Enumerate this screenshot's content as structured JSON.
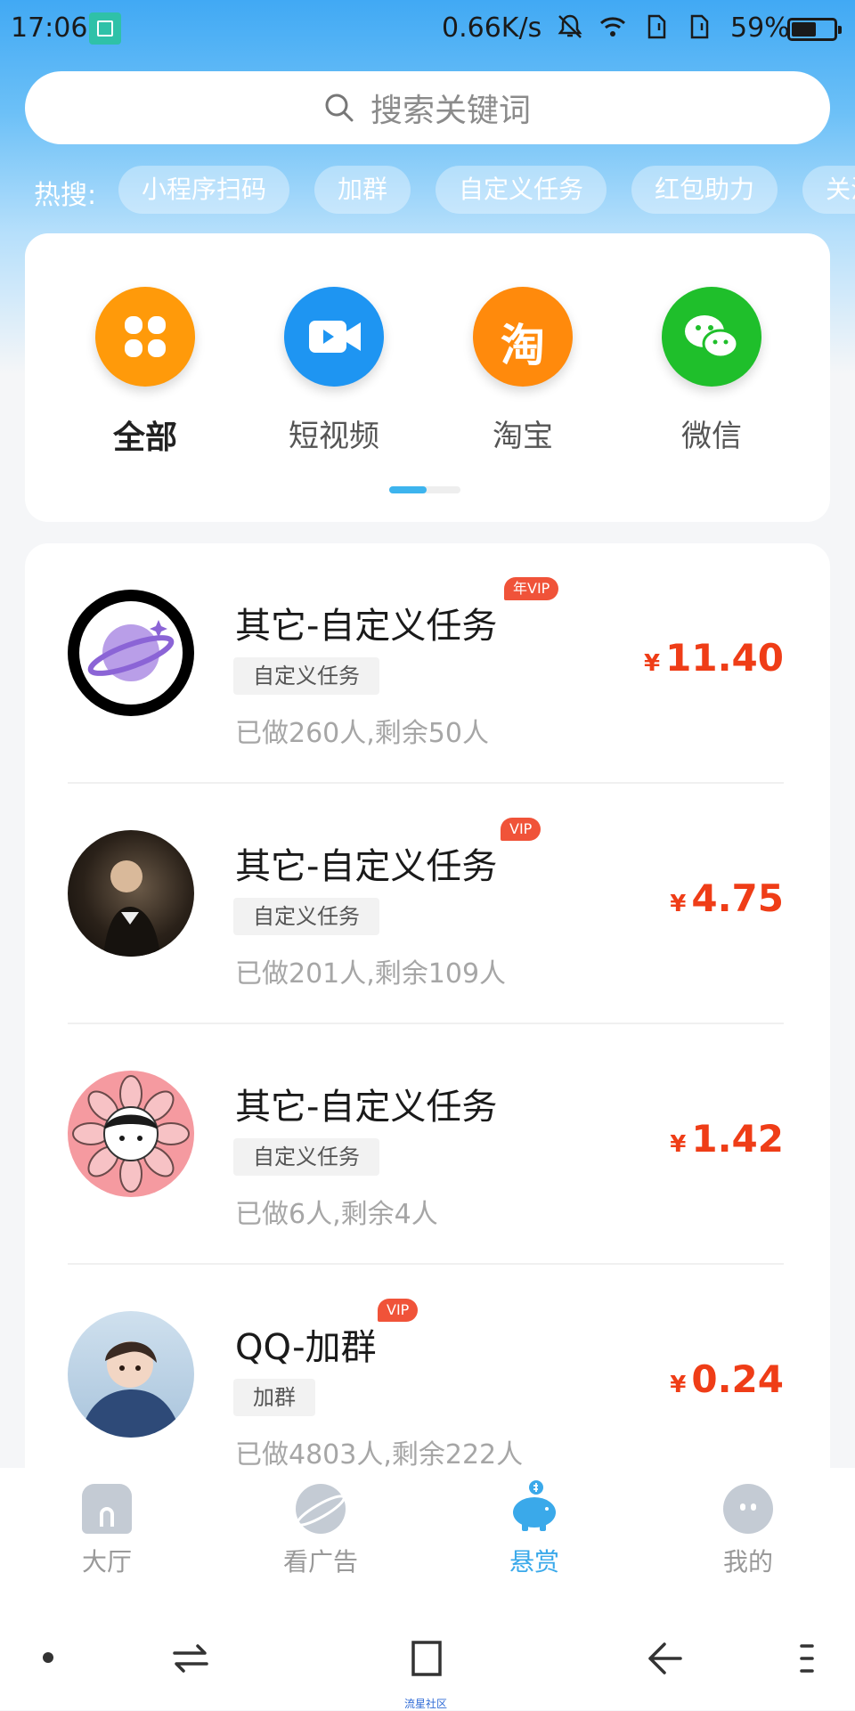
{
  "status_bar": {
    "time": "17:06",
    "network_speed": "0.66K/s",
    "battery_percent": "59%",
    "battery_level": 0.59
  },
  "search": {
    "placeholder": "搜索关键词"
  },
  "hot_search": {
    "label": "热搜:",
    "chips": [
      "小程序扫码",
      "加群",
      "自定义任务",
      "红包助力",
      "关注"
    ]
  },
  "categories": [
    {
      "label": "全部",
      "icon": "grid-icon",
      "color": "#ff9a0a",
      "active": true
    },
    {
      "label": "短视频",
      "icon": "video-camera-icon",
      "color": "#1e95f2",
      "active": false
    },
    {
      "label": "淘宝",
      "icon": "taobao-icon",
      "icon_char": "淘",
      "color": "#ff8a0c",
      "active": false
    },
    {
      "label": "微信",
      "icon": "wechat-icon",
      "color": "#1fbf2b",
      "active": false
    }
  ],
  "tasks": [
    {
      "title": "其它-自定义任务",
      "vip": "年VIP",
      "tag": "自定义任务",
      "meta": "已做260人,剩余50人",
      "currency": "¥",
      "price": "11.40"
    },
    {
      "title": "其它-自定义任务",
      "vip": "VIP",
      "tag": "自定义任务",
      "meta": "已做201人,剩余109人",
      "currency": "¥",
      "price": "4.75"
    },
    {
      "title": "其它-自定义任务",
      "vip": "",
      "tag": "自定义任务",
      "meta": "已做6人,剩余4人",
      "currency": "¥",
      "price": "1.42"
    },
    {
      "title": "QQ-加群",
      "vip": "VIP",
      "tag": "加群",
      "meta": "已做4803人,剩余222人",
      "currency": "¥",
      "price": "0.24"
    }
  ],
  "tabbar": [
    {
      "label": "大厅",
      "icon": "hall-icon",
      "active": false
    },
    {
      "label": "看广告",
      "icon": "planet-icon",
      "active": false
    },
    {
      "label": "悬赏",
      "icon": "piggy-bank-icon",
      "active": true
    },
    {
      "label": "我的",
      "icon": "profile-face-icon",
      "active": false
    }
  ],
  "watermark": "流星社区",
  "colors": {
    "accent": "#3aa9ea",
    "price": "#ef3d17",
    "vip": "#f05339"
  }
}
